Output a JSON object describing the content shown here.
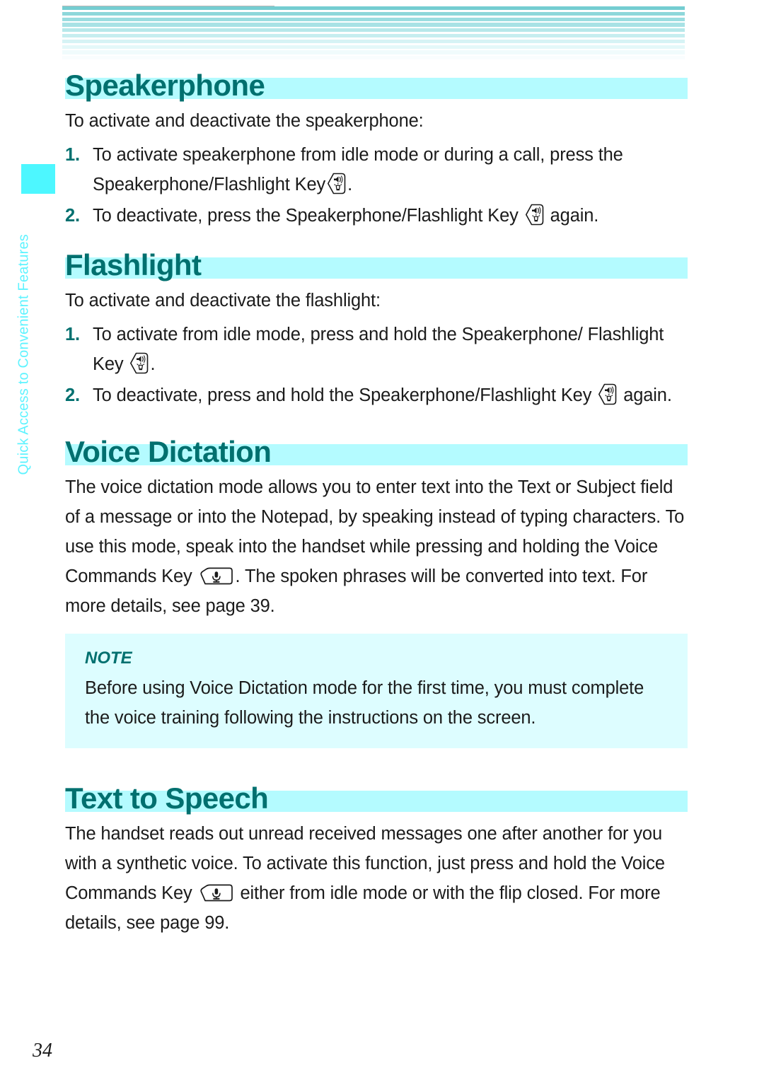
{
  "page": {
    "number": "34",
    "side_tab_label": "Quick Access to Convenient Features",
    "accent_heading_color": "#00706f",
    "heading_bar_color": "#b4fbff",
    "tab_block_color": "#4df7ff",
    "note_box_color": "#ddfdff",
    "side_tab_text_color": "#5ef3ff"
  },
  "header": {
    "stripe_colors": [
      "#74cdd1",
      "#8ed7da",
      "#9bdde0",
      "#a8e2e5",
      "#b7e8ea",
      "#c6eef0",
      "#d6f3f5",
      "#e4f8f9",
      "#f0fbfc",
      "#f9fdfe"
    ]
  },
  "icons": {
    "speakerphone_flashlight_key": "speakerphone-flashlight-key-icon",
    "voice_commands_key": "voice-commands-key-icon"
  },
  "sections": [
    {
      "id": "speakerphone",
      "heading": "Speakerphone",
      "intro": "To activate and deactivate the speakerphone:",
      "steps": [
        {
          "marker": "1.",
          "before": "To activate speakerphone from idle mode or during a call, press the Speakerphone/Flashlight Key",
          "icon": "speakerphone-flashlight-key-icon",
          "after": "."
        },
        {
          "marker": "2.",
          "before": "To deactivate, press the Speakerphone/Flashlight Key",
          "icon": "speakerphone-flashlight-key-icon",
          "after": "again."
        }
      ]
    },
    {
      "id": "flashlight",
      "heading": "Flashlight",
      "intro": "To activate and deactivate the flashlight:",
      "steps": [
        {
          "marker": "1.",
          "before": "To activate from idle mode, press and hold the Speakerphone/ Flashlight Key",
          "icon": "speakerphone-flashlight-key-icon",
          "after": "."
        },
        {
          "marker": "2.",
          "before": "To deactivate, press and hold the Speakerphone/Flashlight Key",
          "icon": "speakerphone-flashlight-key-icon",
          "after": "again."
        }
      ]
    },
    {
      "id": "voice-dictation",
      "heading": "Voice Dictation",
      "body_before": "The voice dictation mode allows you to enter text into the Text or Subject field of a message or into the Notepad, by speaking instead of typing characters. To use this mode, speak into the handset while pressing and holding the Voice Commands Key",
      "icon": "voice-commands-key-icon",
      "body_after": ". The spoken phrases will be converted into text. For more details, see page 39."
    },
    {
      "id": "text-to-speech",
      "heading": "Text to Speech",
      "body_before": "The handset reads out unread received messages one after another for you with a synthetic voice. To activate this function, just press and hold the Voice Commands Key",
      "icon": "voice-commands-key-icon",
      "body_after": "either from idle mode or with the flip closed. For more details, see page 99."
    }
  ],
  "note": {
    "label": "NOTE",
    "text": "Before using Voice Dictation mode for the first time, you must complete the voice training following the instructions on the screen."
  }
}
